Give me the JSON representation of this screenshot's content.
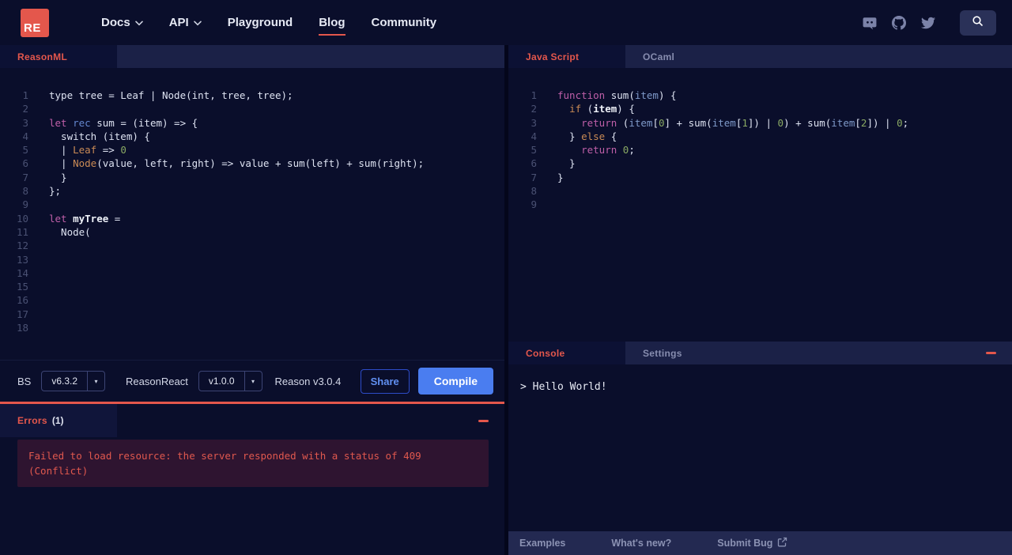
{
  "colors": {
    "accent": "#e4574c",
    "button_blue": "#4a7df0",
    "background": "#0a0e2b"
  },
  "nav": {
    "logo_text": "RE",
    "items": [
      {
        "label": "Docs",
        "chevron": true,
        "active": false
      },
      {
        "label": "API",
        "chevron": true,
        "active": false
      },
      {
        "label": "Playground",
        "chevron": false,
        "active": false
      },
      {
        "label": "Blog",
        "chevron": false,
        "active": true
      },
      {
        "label": "Community",
        "chevron": false,
        "active": false
      }
    ]
  },
  "left_panel": {
    "tab_label": "ReasonML",
    "code_lines": [
      [
        [
          "p",
          "type tree = Leaf | Node(int, tree, tree);"
        ]
      ],
      [],
      [
        [
          "k",
          "let"
        ],
        [
          "p",
          " "
        ],
        [
          "r",
          "rec"
        ],
        [
          "p",
          " sum = (item) => {"
        ]
      ],
      [
        [
          "p",
          "  switch (item) {"
        ]
      ],
      [
        [
          "p",
          "  | "
        ],
        [
          "o",
          "Leaf"
        ],
        [
          "p",
          " => "
        ],
        [
          "n",
          "0"
        ]
      ],
      [
        [
          "p",
          "  | "
        ],
        [
          "o",
          "Node"
        ],
        [
          "p",
          "(value, left, right) => value + sum(left) + sum(right);"
        ]
      ],
      [
        [
          "p",
          "  }"
        ]
      ],
      [
        [
          "p",
          "};"
        ]
      ],
      [],
      [
        [
          "k",
          "let"
        ],
        [
          "p",
          " "
        ],
        [
          "b",
          "myTree"
        ],
        [
          "p",
          " ="
        ]
      ],
      [
        [
          "p",
          "  Node("
        ]
      ],
      [],
      [],
      [],
      [],
      [],
      [],
      []
    ],
    "toolbar": {
      "bs_label": "BS",
      "bs_version": "v6.3.2",
      "reasonreact_label": "ReasonReact",
      "reasonreact_version": "v1.0.0",
      "reason_version": "Reason v3.0.4",
      "share_label": "Share",
      "compile_label": "Compile"
    },
    "errors": {
      "title": "Errors",
      "count": "(1)",
      "message_lines": [
        "Failed to load resource: the server responded with a status of 409",
        "(Conflict)"
      ]
    }
  },
  "right_panel": {
    "tabs": [
      {
        "label": "Java Script",
        "active": true
      },
      {
        "label": "OCaml",
        "active": false
      }
    ],
    "code_lines": [
      [
        [
          "k",
          "function"
        ],
        [
          "p",
          " sum("
        ],
        [
          "v",
          "item"
        ],
        [
          "p",
          ") {"
        ]
      ],
      [
        [
          "p",
          "  "
        ],
        [
          "o",
          "if"
        ],
        [
          "p",
          " ("
        ],
        [
          "b",
          "item"
        ],
        [
          "p",
          ") {"
        ]
      ],
      [
        [
          "p",
          "    "
        ],
        [
          "k",
          "return"
        ],
        [
          "p",
          " ("
        ],
        [
          "v",
          "item"
        ],
        [
          "p",
          "["
        ],
        [
          "n",
          "0"
        ],
        [
          "p",
          "] + sum("
        ],
        [
          "v",
          "item"
        ],
        [
          "p",
          "["
        ],
        [
          "n",
          "1"
        ],
        [
          "p",
          "]) | "
        ],
        [
          "n",
          "0"
        ],
        [
          "p",
          ") + sum("
        ],
        [
          "v",
          "item"
        ],
        [
          "p",
          "["
        ],
        [
          "n",
          "2"
        ],
        [
          "p",
          "]) | "
        ],
        [
          "n",
          "0"
        ],
        [
          "p",
          ";"
        ]
      ],
      [
        [
          "p",
          "  } "
        ],
        [
          "o",
          "else"
        ],
        [
          "p",
          " {"
        ]
      ],
      [
        [
          "p",
          "    "
        ],
        [
          "k",
          "return"
        ],
        [
          "p",
          " "
        ],
        [
          "n",
          "0"
        ],
        [
          "p",
          ";"
        ]
      ],
      [
        [
          "p",
          "  }"
        ]
      ],
      [
        [
          "p",
          "}"
        ]
      ],
      [],
      []
    ],
    "console": {
      "tab_label": "Console",
      "settings_label": "Settings",
      "output": "> Hello World!"
    },
    "footer": [
      {
        "label": "Examples",
        "external_icon": false
      },
      {
        "label": "What's new?",
        "external_icon": false
      },
      {
        "label": "Submit Bug",
        "external_icon": true
      }
    ]
  }
}
